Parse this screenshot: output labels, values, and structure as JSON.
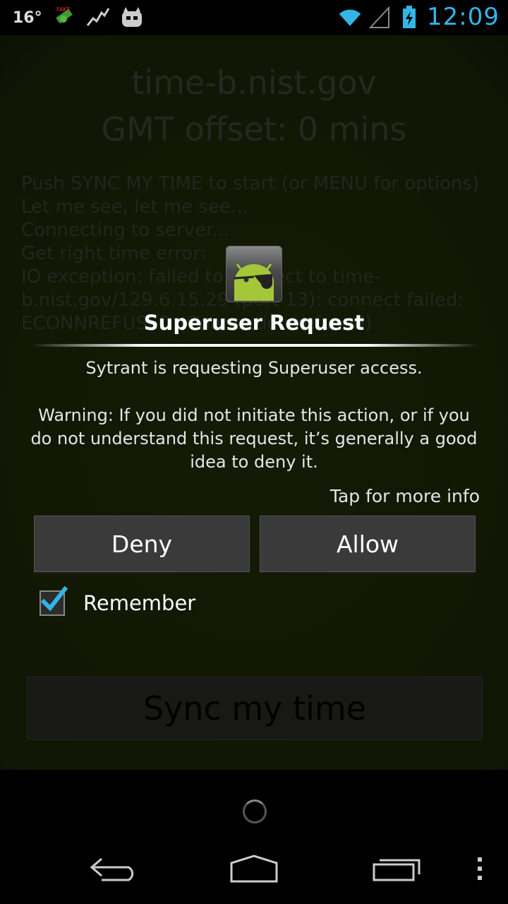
{
  "status_bar": {
    "temperature": "16°",
    "time": "12:09",
    "icons": [
      "fake-location-icon",
      "activity-graph-icon",
      "cyanogen-mascot-icon",
      "wifi-icon",
      "signal-icon",
      "battery-charging-icon"
    ]
  },
  "app": {
    "host": "time-b.nist.gov",
    "gmt_offset": "GMT offset: 0 mins",
    "log": "Push SYNC MY TIME to start (or MENU for options)\nLet me see, let me see...\nConnecting to server...\nGet right time error:\nIO exception: failed to connect to time-b.nist.gov/129.6.15.29 (port 13): connect failed: ECONNREFUSED (Connection refused)",
    "sync_button": "Sync my time"
  },
  "dialog": {
    "icon": "superuser-android-icon",
    "title": "Superuser Request",
    "message": "Sytrant is requesting Superuser access.",
    "warning": "Warning: If you did not initiate this action, or if you do not understand this request, it’s generally a good idea to deny it.",
    "more_info": "Tap for more info",
    "deny_label": "Deny",
    "allow_label": "Allow",
    "remember_label": "Remember",
    "remember_checked": true
  },
  "colors": {
    "accent": "#33b5e5",
    "android_green": "#a4c639"
  },
  "navbar": {
    "icons": [
      "back-icon",
      "home-icon",
      "recent-apps-icon",
      "overflow-menu-icon"
    ]
  }
}
